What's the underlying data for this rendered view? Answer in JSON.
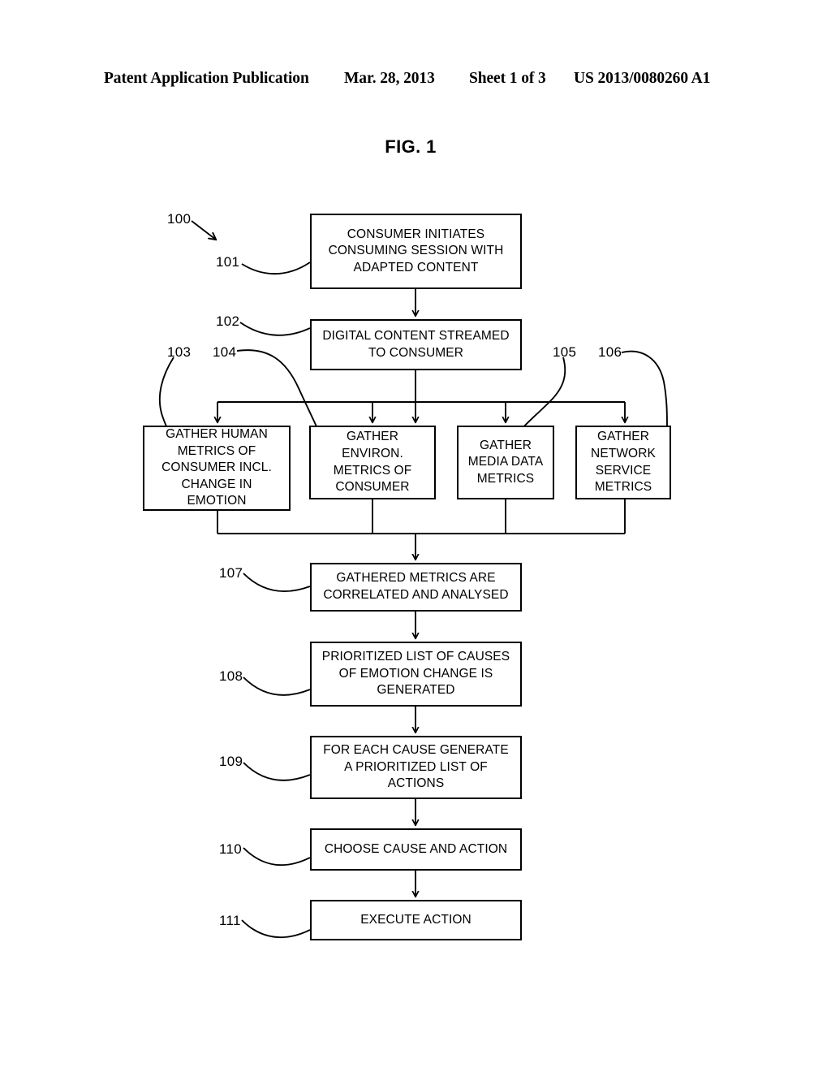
{
  "header": {
    "publication": "Patent Application Publication",
    "date": "Mar. 28, 2013",
    "sheet": "Sheet 1 of 3",
    "document_number": "US 2013/0080260 A1"
  },
  "figure": {
    "label": "FIG. 1",
    "diagram_numeral": "100"
  },
  "boxes": [
    {
      "ref": "101",
      "text": "CONSUMER INITIATES\nCONSUMING SESSION WITH\nADAPTED CONTENT"
    },
    {
      "ref": "102",
      "text": "DIGITAL CONTENT STREAMED\nTO CONSUMER"
    },
    {
      "ref": "103",
      "text": "GATHER HUMAN\nMETRICS OF\nCONSUMER INCL.\nCHANGE IN\nEMOTION"
    },
    {
      "ref": "104",
      "text": "GATHER\nENVIRON.\nMETRICS OF\nCONSUMER"
    },
    {
      "ref": "105",
      "text": "GATHER\nMEDIA DATA\nMETRICS"
    },
    {
      "ref": "106",
      "text": "GATHER\nNETWORK\nSERVICE\nMETRICS"
    },
    {
      "ref": "107",
      "text": "GATHERED METRICS ARE\nCORRELATED AND ANALYSED"
    },
    {
      "ref": "108",
      "text": "PRIORITIZED LIST OF CAUSES\nOF EMOTION CHANGE IS\nGENERATED"
    },
    {
      "ref": "109",
      "text": "FOR EACH CAUSE GENERATE\nA PRIORITIZED LIST OF\nACTIONS"
    },
    {
      "ref": "110",
      "text": "CHOOSE CAUSE AND ACTION"
    },
    {
      "ref": "111",
      "text": "EXECUTE ACTION"
    }
  ],
  "colors": {
    "ink": "#000000",
    "paper": "#ffffff"
  }
}
